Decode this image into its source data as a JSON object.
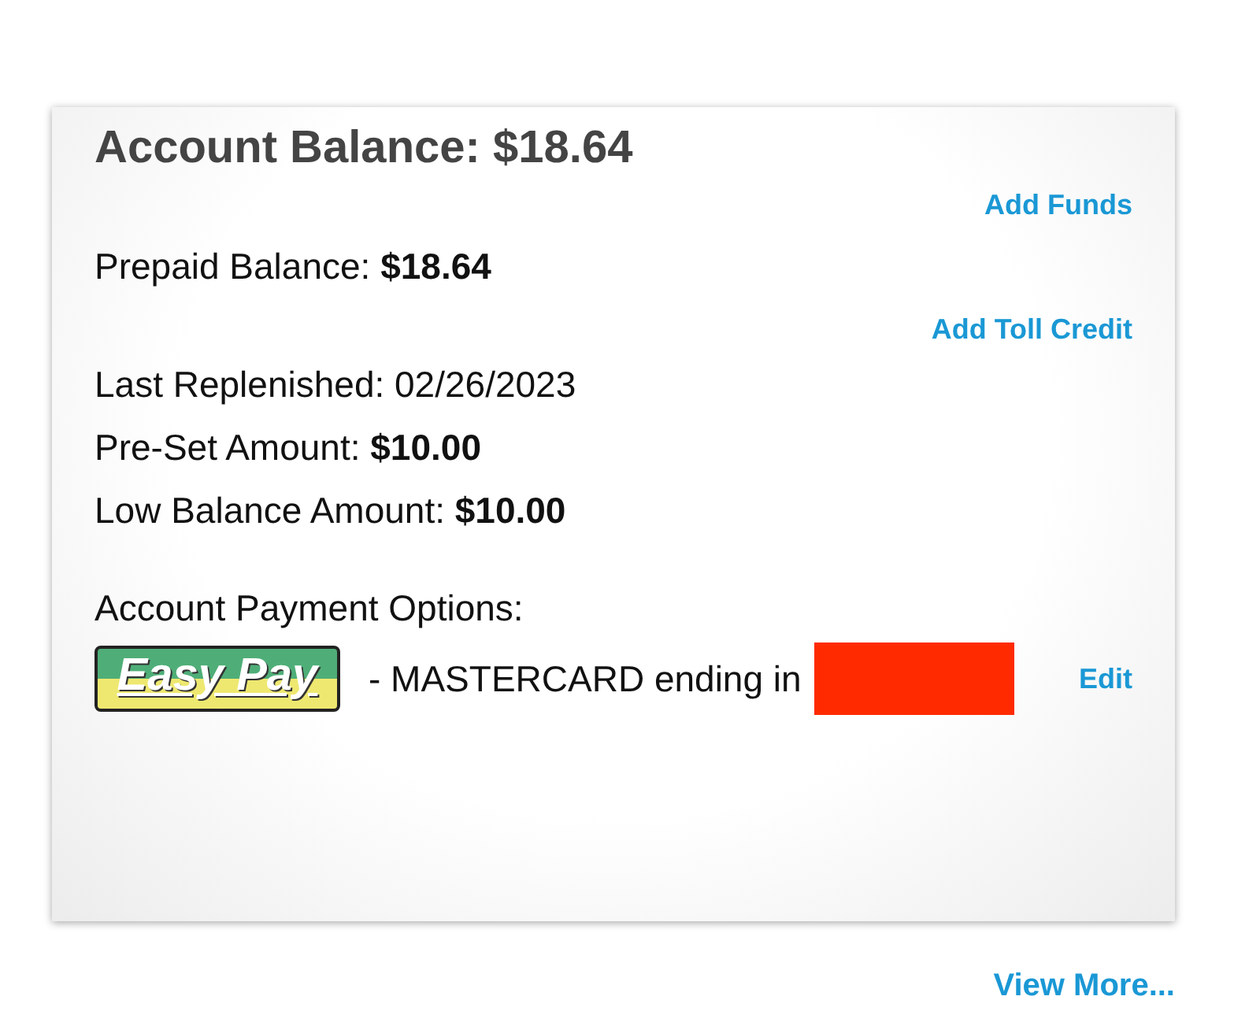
{
  "card": {
    "title": "Account Balance: $18.64",
    "add_funds": "Add Funds",
    "prepaid": {
      "label": "Prepaid Balance:",
      "value": "$18.64"
    },
    "add_toll_credit": "Add Toll Credit",
    "details": [
      {
        "label": "Last Replenished:",
        "value": "02/26/2023",
        "bold": false
      },
      {
        "label": "Pre-Set Amount:",
        "value": "$10.00",
        "bold": true
      },
      {
        "label": "Low Balance Amount:",
        "value": "$10.00",
        "bold": true
      }
    ],
    "payment_heading": "Account Payment Options:",
    "payment": {
      "logo": "Easy Pay",
      "text": "- MASTERCARD ending in",
      "redacted": true,
      "edit": "Edit"
    }
  },
  "view_more": "View More..."
}
